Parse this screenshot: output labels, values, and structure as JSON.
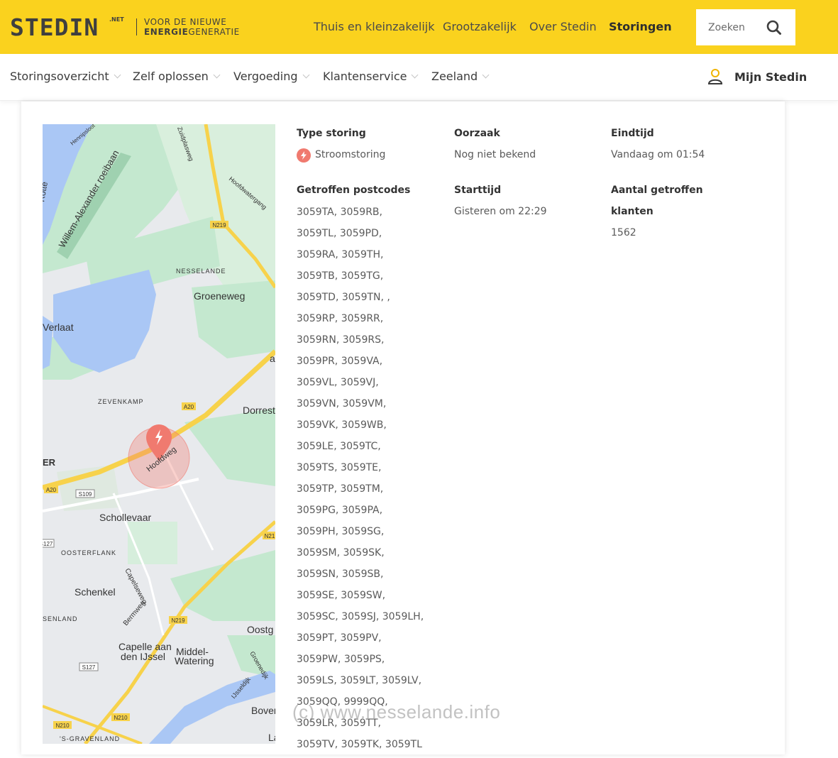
{
  "header": {
    "logo_word": "STEDIN",
    "logo_suffix": ".NET",
    "tagline_line1": "VOOR DE NIEUWE",
    "tagline_bold": "ENERGIE",
    "tagline_rest": "GENERATIE",
    "nav": [
      {
        "label": "Thuis en kleinzakelijk"
      },
      {
        "label": "Grootzakelijk"
      },
      {
        "label": "Over Stedin"
      },
      {
        "label": "Storingen",
        "active": true
      }
    ],
    "search_placeholder": "Zoeken",
    "search_icon": "search-icon"
  },
  "subnav": {
    "items": [
      "Storingsoverzicht",
      "Zelf oplossen",
      "Vergoeding",
      "Klantenservice",
      "Zeeland"
    ],
    "account_label": "Mijn Stedin",
    "account_icon": "user-icon"
  },
  "details": {
    "type_label": "Type storing",
    "type_value": "Stroomstoring",
    "cause_label": "Oorzaak",
    "cause_value": "Nog niet bekend",
    "end_label": "Eindtijd",
    "end_value": "Vandaag om 01:54",
    "postcodes_label": "Getroffen postcodes",
    "start_label": "Starttijd",
    "start_value": "Gisteren om 22:29",
    "customers_label_1": "Aantal getroffen",
    "customers_label_2": "klanten",
    "customers_value": "1562",
    "postcodes": [
      "3059TA, 3059RB,",
      "3059TL, 3059PD,",
      "3059RA, 3059TH,",
      "3059TB, 3059TG,",
      "3059TD, 3059TN, ,",
      "3059RP, 3059RR,",
      "3059RN, 3059RS,",
      "3059PR, 3059VA,",
      "3059VL, 3059VJ,",
      "3059VN, 3059VM,",
      "3059VK, 3059WB,",
      "3059LE, 3059TC,",
      "3059TS, 3059TE,",
      "3059TP, 3059TM,",
      "3059PG, 3059PA,",
      "3059PH, 3059SG,",
      "3059SM, 3059SK,",
      "3059SN, 3059SB,",
      "3059SE, 3059SW,",
      "3059SC, 3059SJ, 3059LH,",
      "3059PT, 3059PV,",
      "3059PW, 3059PS,",
      "3059LS, 3059LT, 3059LV,",
      "3059QQ, 9999QQ,",
      "3059LR, 3059TT,",
      "3059TV, 3059TK, 3059TL"
    ]
  },
  "map": {
    "labels": {
      "nesselande": "NESSELANDE",
      "groeneweg": "Groeneweg",
      "verlaat": "Verlaat",
      "zevenkamp": "ZEVENKAMP",
      "dorrest": "Dorrest",
      "er": "ER",
      "hoofdweg": "Hoofdweg",
      "schollevaar": "Schollevaar",
      "oosterflank": "OOSTERFLANK",
      "capelseweg": "Capelseweg",
      "schenkel": "Schenkel",
      "bermweg": "Bermweg",
      "senland": "SENLAND",
      "oostg": "Oostg",
      "capelle1": "Capelle aan",
      "capelle2": "den IJssel",
      "middel1": "Middel-",
      "middel2": "Watering",
      "groenedijk": "Groenedijk",
      "ijsseldijk": "IJsseldijk",
      "bover": "Bover",
      "sgravenland": "'S-GRAVENLAND",
      "la": "La",
      "roeibaan": "Willem-Alexander roeibaan",
      "hennipsloot": "Hennipsloot",
      "zuidplasweg": "Zuidplasweg",
      "hoofdwatergang": "Hoofdwatergang",
      "rotte": "Rotte",
      "a": "a"
    },
    "shields": {
      "n219a": "N219",
      "a20a": "A20",
      "a20b": "A20",
      "s109": "S109",
      "s127a": "S127",
      "n21": "N21",
      "n219b": "N219",
      "s127b": "S127",
      "n210a": "N210",
      "n210b": "N210"
    },
    "marker_icon": "lightning-bolt-icon",
    "colors": {
      "water": "#aac7f5",
      "green": "#c4e8cf",
      "urban": "#e8eaed",
      "highway": "#f7d24b",
      "marker": "#f07a6f"
    }
  },
  "watermark": "(c)  www.nesselande.info"
}
